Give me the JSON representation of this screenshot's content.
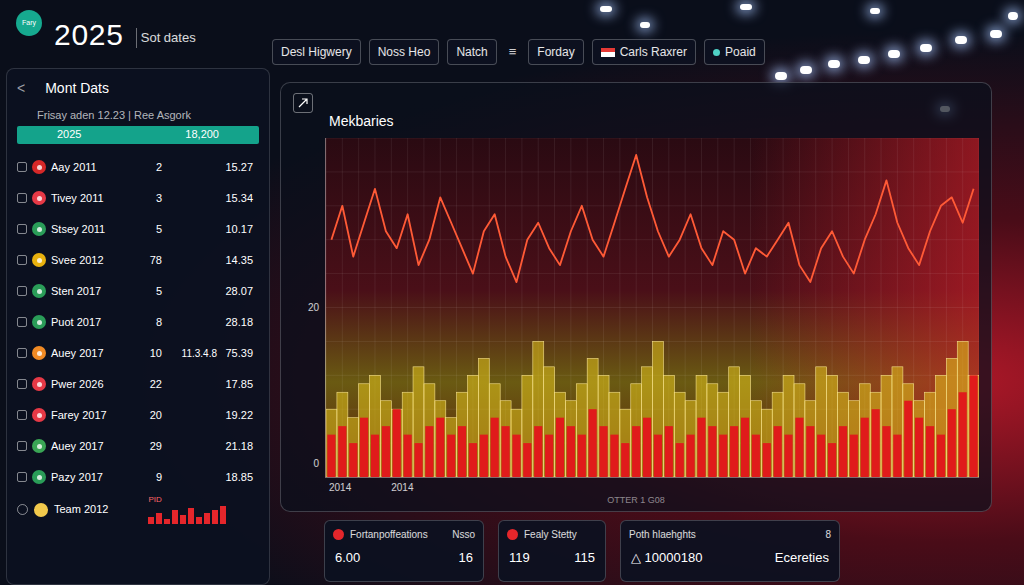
{
  "header": {
    "logo": "Fary",
    "year": "2025",
    "subtitle": "Sot dates"
  },
  "tabs": [
    {
      "label": "Desl Higwery",
      "kind": "pill",
      "selected": false
    },
    {
      "label": "Noss Heo",
      "kind": "pill",
      "selected": false
    },
    {
      "label": "Natch",
      "kind": "pill",
      "selected": false
    },
    {
      "label": "≡",
      "kind": "glyph",
      "selected": false
    },
    {
      "label": "Forday",
      "kind": "pill",
      "selected": false
    },
    {
      "label": "Carls Raxrer",
      "kind": "flag",
      "selected": false
    },
    {
      "label": "Poaid",
      "kind": "dot",
      "selected": false
    }
  ],
  "sidebar": {
    "back": "<",
    "title": "Mont Dats",
    "subheader": "Frisay aden 12.23 | Ree Asgork",
    "highlight": {
      "left": "2025",
      "right": "18,200"
    },
    "rows": [
      {
        "label": "Aay 2011",
        "count": "2",
        "value": "15.27",
        "checked": false,
        "color": "#d62828"
      },
      {
        "label": "Tivey 2011",
        "count": "3",
        "value": "15.34",
        "checked": false,
        "color": "#e63946"
      },
      {
        "label": "Stsey 2011",
        "count": "5",
        "value": "10.17",
        "checked": false,
        "color": "#2a9d58"
      },
      {
        "label": "Svee 2012",
        "count": "78",
        "value": "14.35",
        "checked": false,
        "color": "#e8b10e"
      },
      {
        "label": "Sten 2017",
        "count": "5",
        "value": "28.07",
        "checked": false,
        "color": "#2a9d58"
      },
      {
        "label": "Puot 2017",
        "count": "8",
        "value": "28.18",
        "checked": false,
        "color": "#2a9d58"
      },
      {
        "label": "Auey 2017",
        "count": "10",
        "extra": "11.3.4.8",
        "value": "75.39",
        "checked": false,
        "color": "#f08a24"
      },
      {
        "label": "Pwer 2026",
        "count": "22",
        "value": "17.85",
        "checked": false,
        "color": "#e63946"
      },
      {
        "label": "Farey 2017",
        "count": "20",
        "value": "19.22",
        "checked": false,
        "color": "#e63946"
      },
      {
        "label": "Auey 2017",
        "count": "29",
        "value": "21.18",
        "checked": false,
        "color": "#3aa655"
      },
      {
        "label": "Pazy 2017",
        "count": "9",
        "value": "18.85",
        "checked": false,
        "color": "#2a9d58"
      }
    ],
    "footer": {
      "label": "Team 2012",
      "tag": "PID",
      "color": "#f2c94c",
      "bars": [
        3,
        5,
        2,
        6,
        4,
        7,
        3,
        5,
        6,
        8
      ]
    }
  },
  "chart": {
    "title": "Mekbaries",
    "y_ticks": [
      "20",
      "0"
    ],
    "x_labels": [
      "2014",
      "2014"
    ],
    "footer": "OTTER 1 G08",
    "series": [
      {
        "kind": "line",
        "color": "#ff5a36",
        "values": [
          28,
          32,
          26,
          30,
          34,
          29,
          27,
          31,
          25,
          28,
          33,
          30,
          27,
          24,
          29,
          31,
          26,
          23,
          28,
          30,
          27,
          25,
          29,
          32,
          28,
          26,
          30,
          34,
          38,
          33,
          29,
          26,
          28,
          31,
          27,
          25,
          29,
          28,
          24,
          27,
          26,
          28,
          30,
          25,
          23,
          27,
          29,
          26,
          24,
          28,
          31,
          35,
          30,
          27,
          25,
          29,
          32,
          33,
          30,
          34
        ]
      },
      {
        "kind": "bars",
        "color": "#e2c21c",
        "values": [
          8,
          10,
          7,
          11,
          12,
          9,
          8,
          10,
          13,
          11,
          9,
          7,
          10,
          12,
          14,
          11,
          9,
          8,
          12,
          16,
          13,
          10,
          9,
          11,
          14,
          12,
          10,
          8,
          11,
          13,
          16,
          12,
          10,
          9,
          12,
          11,
          10,
          13,
          12,
          9,
          8,
          10,
          12,
          11,
          9,
          13,
          12,
          10,
          9,
          11,
          10,
          12,
          13,
          11,
          9,
          10,
          12,
          14,
          16,
          12
        ]
      },
      {
        "kind": "bars",
        "color": "#e01b1b",
        "values": [
          5,
          6,
          4,
          7,
          5,
          6,
          8,
          5,
          4,
          6,
          7,
          5,
          6,
          4,
          5,
          7,
          6,
          5,
          4,
          6,
          5,
          7,
          6,
          5,
          8,
          6,
          5,
          4,
          6,
          7,
          5,
          6,
          4,
          5,
          7,
          6,
          5,
          6,
          7,
          5,
          4,
          6,
          5,
          7,
          6,
          5,
          4,
          6,
          5,
          7,
          8,
          6,
          5,
          9,
          7,
          6,
          5,
          8,
          10,
          12
        ]
      }
    ]
  },
  "cards": [
    {
      "kind": "dot",
      "title": "Fortanpoffeations",
      "aside": "Nsso",
      "values": [
        "6.00",
        "16"
      ]
    },
    {
      "kind": "dot",
      "title": "Fealy Stetty",
      "values": [
        "119",
        "115"
      ]
    },
    {
      "kind": "plain",
      "title": "Poth hlaehghts",
      "aside": "8",
      "values": [
        "△ 10000180",
        "Ecereties"
      ]
    }
  ]
}
